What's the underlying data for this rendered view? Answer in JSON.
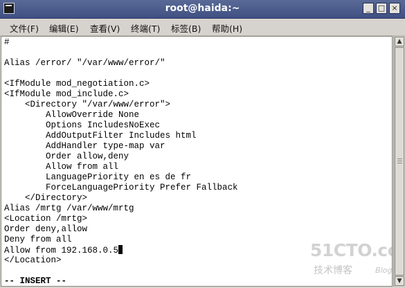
{
  "window": {
    "title": "root@haida:~",
    "controls": [
      "_",
      "□",
      "×"
    ]
  },
  "menu": [
    {
      "label": "文件(F)"
    },
    {
      "label": "编辑(E)"
    },
    {
      "label": "查看(V)"
    },
    {
      "label": "终端(T)"
    },
    {
      "label": "标签(B)"
    },
    {
      "label": "帮助(H)"
    }
  ],
  "terminal": {
    "lines": [
      "#",
      "",
      "Alias /error/ \"/var/www/error/\"",
      "",
      "<IfModule mod_negotiation.c>",
      "<IfModule mod_include.c>",
      "    <Directory \"/var/www/error\">",
      "        AllowOverride None",
      "        Options IncludesNoExec",
      "        AddOutputFilter Includes html",
      "        AddHandler type-map var",
      "        Order allow,deny",
      "        Allow from all",
      "        LanguagePriority en es de fr",
      "        ForceLanguagePriority Prefer Fallback",
      "    </Directory>",
      "Alias /mrtg /var/www/mrtg",
      "<Location /mrtg>",
      "Order deny,allow",
      "Deny from all",
      "Allow from 192.168.0.5",
      "</Location>",
      ""
    ],
    "status": "-- INSERT --"
  },
  "watermark": {
    "main": "51CTO.com",
    "sub": "技术博客",
    "blog": "Blog"
  }
}
